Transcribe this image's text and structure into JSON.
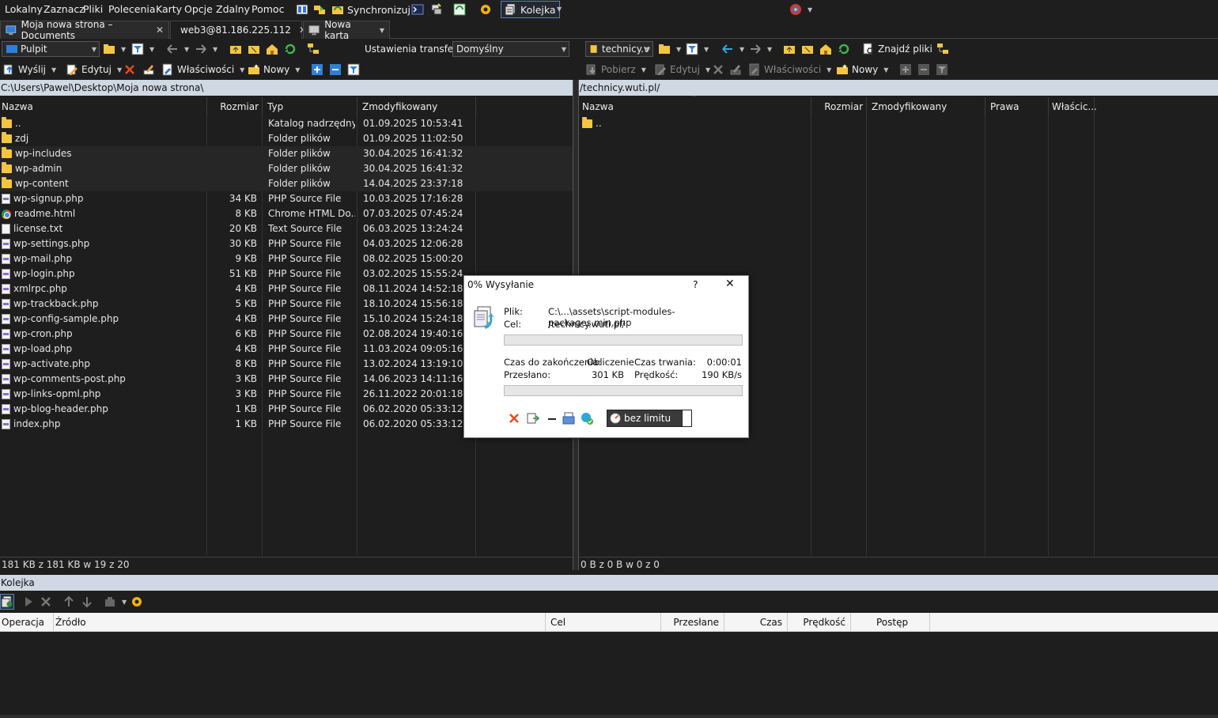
{
  "menu": [
    "Lokalny",
    "Zaznacz",
    "Pliki",
    "Polecenia",
    "Karty",
    "Opcje",
    "Zdalny",
    "Pomoc"
  ],
  "toolbar_top": {
    "sync_label": "Synchronizuj",
    "queue_label": "Kolejka"
  },
  "tabs": [
    {
      "label": "Moja nowa strona – Documents",
      "close": "✕"
    },
    {
      "label": "web3@81.186.225.112",
      "close": "✕"
    },
    {
      "label": "Nowa karta",
      "close": ""
    }
  ],
  "left": {
    "drive": "Pulpit",
    "transfer_settings_label": "Ustawienia transferu",
    "transfer_settings_value": "Domyślny",
    "actions": {
      "send": "Wyślij",
      "edit": "Edytuj",
      "properties": "Właściwości",
      "new": "Nowy"
    },
    "path": "C:\\Users\\Pawel\\Desktop\\Moja nowa strona\\",
    "columns": [
      "Nazwa",
      "Rozmiar",
      "Typ",
      "Zmodyfikowany"
    ],
    "files": [
      {
        "name": "..",
        "size": "",
        "type": "Katalog nadrzędny",
        "modified": "01.09.2025 10:53:41",
        "icon": "parent"
      },
      {
        "name": "zdj",
        "size": "",
        "type": "Folder plików",
        "modified": "01.09.2025 11:02:50",
        "icon": "folder"
      },
      {
        "name": "wp-includes",
        "size": "",
        "type": "Folder plików",
        "modified": "30.04.2025 16:41:32",
        "icon": "folder"
      },
      {
        "name": "wp-admin",
        "size": "",
        "type": "Folder plików",
        "modified": "30.04.2025 16:41:32",
        "icon": "folder"
      },
      {
        "name": "wp-content",
        "size": "",
        "type": "Folder plików",
        "modified": "14.04.2025 23:37:18",
        "icon": "folder"
      },
      {
        "name": "wp-signup.php",
        "size": "34 KB",
        "type": "PHP Source File",
        "modified": "10.03.2025 17:16:28",
        "icon": "php"
      },
      {
        "name": "readme.html",
        "size": "8 KB",
        "type": "Chrome HTML Do...",
        "modified": "07.03.2025 07:45:24",
        "icon": "chrome"
      },
      {
        "name": "license.txt",
        "size": "20 KB",
        "type": "Text Source File",
        "modified": "06.03.2025 13:24:24",
        "icon": "txt"
      },
      {
        "name": "wp-settings.php",
        "size": "30 KB",
        "type": "PHP Source File",
        "modified": "04.03.2025 12:06:28",
        "icon": "php"
      },
      {
        "name": "wp-mail.php",
        "size": "9 KB",
        "type": "PHP Source File",
        "modified": "08.02.2025 15:00:20",
        "icon": "php"
      },
      {
        "name": "wp-login.php",
        "size": "51 KB",
        "type": "PHP Source File",
        "modified": "03.02.2025 15:55:24",
        "icon": "php"
      },
      {
        "name": "xmlrpc.php",
        "size": "4 KB",
        "type": "PHP Source File",
        "modified": "08.11.2024 14:52:18",
        "icon": "php"
      },
      {
        "name": "wp-trackback.php",
        "size": "5 KB",
        "type": "PHP Source File",
        "modified": "18.10.2024 15:56:18",
        "icon": "php"
      },
      {
        "name": "wp-config-sample.php",
        "size": "4 KB",
        "type": "PHP Source File",
        "modified": "15.10.2024 15:24:18",
        "icon": "php"
      },
      {
        "name": "wp-cron.php",
        "size": "6 KB",
        "type": "PHP Source File",
        "modified": "02.08.2024 19:40:16",
        "icon": "php"
      },
      {
        "name": "wp-load.php",
        "size": "4 KB",
        "type": "PHP Source File",
        "modified": "11.03.2024 09:05:16",
        "icon": "php"
      },
      {
        "name": "wp-activate.php",
        "size": "8 KB",
        "type": "PHP Source File",
        "modified": "13.02.2024 13:19:10",
        "icon": "php"
      },
      {
        "name": "wp-comments-post.php",
        "size": "3 KB",
        "type": "PHP Source File",
        "modified": "14.06.2023 14:11:16",
        "icon": "php"
      },
      {
        "name": "wp-links-opml.php",
        "size": "3 KB",
        "type": "PHP Source File",
        "modified": "26.11.2022 20:01:18",
        "icon": "php"
      },
      {
        "name": "wp-blog-header.php",
        "size": "1 KB",
        "type": "PHP Source File",
        "modified": "06.02.2020 05:33:12",
        "icon": "php"
      },
      {
        "name": "index.php",
        "size": "1 KB",
        "type": "PHP Source File",
        "modified": "06.02.2020 05:33:12",
        "icon": "php"
      }
    ],
    "status": "181 KB z 181 KB w 19 z 20"
  },
  "right": {
    "drive": "technicy.v",
    "find_label": "Znajdź pliki",
    "actions": {
      "download": "Pobierz",
      "edit": "Edytuj",
      "properties": "Właściwości",
      "new": "Nowy"
    },
    "path": "/technicy.wuti.pl/",
    "columns": [
      "Nazwa",
      "Rozmiar",
      "Zmodyfikowany",
      "Prawa",
      "Właścic..."
    ],
    "files": [
      {
        "name": "..",
        "icon": "parent"
      }
    ],
    "status": "0 B z 0 B w 0 z 0"
  },
  "queue": {
    "title": "Kolejka",
    "columns": [
      "Operacja",
      "Źródło",
      "Cel",
      "Przesłane",
      "Czas",
      "Prędkość",
      "Postęp"
    ]
  },
  "dialog": {
    "title": "0% Wysyłanie",
    "help": "?",
    "close": "✕",
    "file_label": "Plik:",
    "file_value": "C:\\...\\assets\\script-modules-packages.min.php",
    "target_label": "Cel:",
    "target_value": "/technicy.wuti.pl/",
    "remaining_label": "Czas do zakończenia:",
    "remaining_value": "Obliczenie",
    "duration_label": "Czas trwania:",
    "duration_value": "0:00:01",
    "sent_label": "Przesłano:",
    "sent_value": "301 KB",
    "speed_label": "Prędkość:",
    "speed_value": "190 KB/s",
    "speed_limit": "bez limitu",
    "file_progress": 0,
    "total_progress": 0
  },
  "colors": {
    "accent": "#5a7fbf",
    "pathbar": "#cfd8e3",
    "folder": "#f4c542",
    "cancel": "#e8491d"
  }
}
